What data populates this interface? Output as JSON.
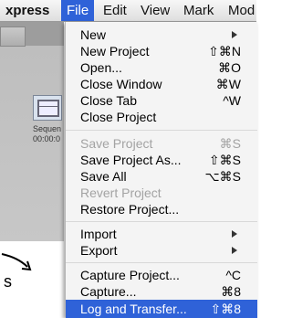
{
  "menubar": {
    "app": "xpress",
    "items": [
      "File",
      "Edit",
      "View",
      "Mark",
      "Mod"
    ]
  },
  "background": {
    "clip_label": "Sequen",
    "clip_timecode": "00:00:0",
    "partial_char": "s"
  },
  "file_menu": {
    "items": [
      {
        "label": "New",
        "shortcut": "",
        "submenu": true,
        "enabled": true
      },
      {
        "label": "New Project",
        "shortcut": "⇧⌘N",
        "enabled": true
      },
      {
        "label": "Open...",
        "shortcut": "⌘O",
        "enabled": true
      },
      {
        "label": "Close Window",
        "shortcut": "⌘W",
        "enabled": true
      },
      {
        "label": "Close Tab",
        "shortcut": "^W",
        "enabled": true
      },
      {
        "label": "Close Project",
        "shortcut": "",
        "enabled": true
      },
      {
        "label": "Save Project",
        "shortcut": "⌘S",
        "enabled": false
      },
      {
        "label": "Save Project As...",
        "shortcut": "⇧⌘S",
        "enabled": true
      },
      {
        "label": "Save All",
        "shortcut": "⌥⌘S",
        "enabled": true
      },
      {
        "label": "Revert Project",
        "shortcut": "",
        "enabled": false
      },
      {
        "label": "Restore Project...",
        "shortcut": "",
        "enabled": true
      },
      {
        "label": "Import",
        "shortcut": "",
        "submenu": true,
        "enabled": true
      },
      {
        "label": "Export",
        "shortcut": "",
        "submenu": true,
        "enabled": true
      },
      {
        "label": "Capture Project...",
        "shortcut": "^C",
        "enabled": true
      },
      {
        "label": "Capture...",
        "shortcut": "⌘8",
        "enabled": true
      },
      {
        "label": "Log and Transfer...",
        "shortcut": "⇧⌘8",
        "enabled": true,
        "highlighted": true
      }
    ]
  },
  "colors": {
    "highlight": "#2f62d8",
    "disabled_text": "#a3a3a3"
  }
}
